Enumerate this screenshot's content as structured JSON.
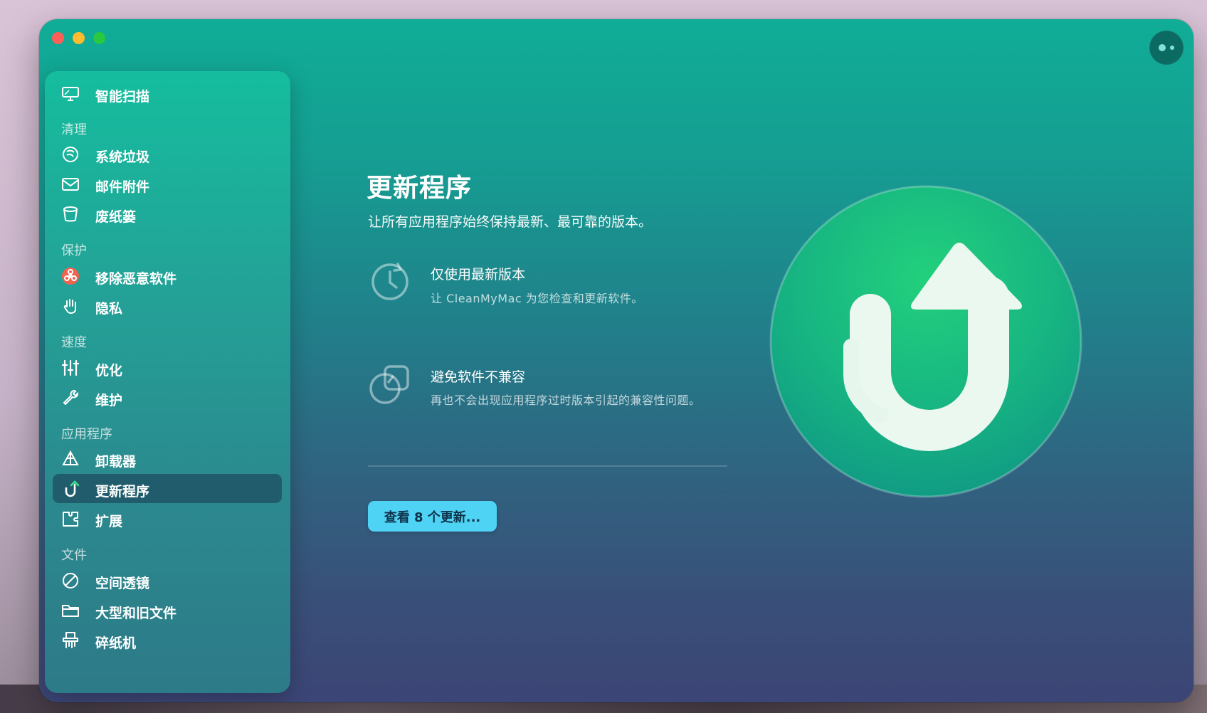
{
  "window": {
    "traffic_lights": [
      "close",
      "minimize",
      "zoom"
    ],
    "assistant_icon": "assistant-eyes-icon"
  },
  "sidebar": {
    "top_item": {
      "label": "智能扫描",
      "icon": "monitor-scan-icon"
    },
    "sections": [
      {
        "label": "清理",
        "items": [
          {
            "label": "系统垃圾",
            "icon": "system-junk-icon"
          },
          {
            "label": "邮件附件",
            "icon": "mail-icon"
          },
          {
            "label": "废纸篓",
            "icon": "trash-icon"
          }
        ]
      },
      {
        "label": "保护",
        "items": [
          {
            "label": "移除恶意软件",
            "icon": "biohazard-icon"
          },
          {
            "label": "隐私",
            "icon": "hand-icon"
          }
        ]
      },
      {
        "label": "速度",
        "items": [
          {
            "label": "优化",
            "icon": "sliders-icon"
          },
          {
            "label": "维护",
            "icon": "wrench-icon"
          }
        ]
      },
      {
        "label": "应用程序",
        "items": [
          {
            "label": "卸载器",
            "icon": "uninstaller-icon"
          },
          {
            "label": "更新程序",
            "icon": "updater-icon",
            "active": true
          },
          {
            "label": "扩展",
            "icon": "extensions-icon"
          }
        ]
      },
      {
        "label": "文件",
        "items": [
          {
            "label": "空间透镜",
            "icon": "space-lens-icon"
          },
          {
            "label": "大型和旧文件",
            "icon": "folder-icon"
          },
          {
            "label": "碎纸机",
            "icon": "shredder-icon"
          }
        ]
      }
    ]
  },
  "main": {
    "title": "更新程序",
    "subtitle": "让所有应用程序始终保持最新、最可靠的版本。",
    "features": [
      {
        "title": "仅使用最新版本",
        "desc": "让 CleanMyMac 为您检查和更新软件。",
        "icon": "clock-refresh-icon"
      },
      {
        "title": "避免软件不兼容",
        "desc": "再也不会出现应用程序过时版本引起的兼容性问题。",
        "icon": "overlap-squares-icon"
      }
    ],
    "cta_label": "查看 8 个更新...",
    "hero_icon": "updater-hero-icon",
    "accent": "#4fd3f4",
    "hero_color": "#1fc37e"
  }
}
